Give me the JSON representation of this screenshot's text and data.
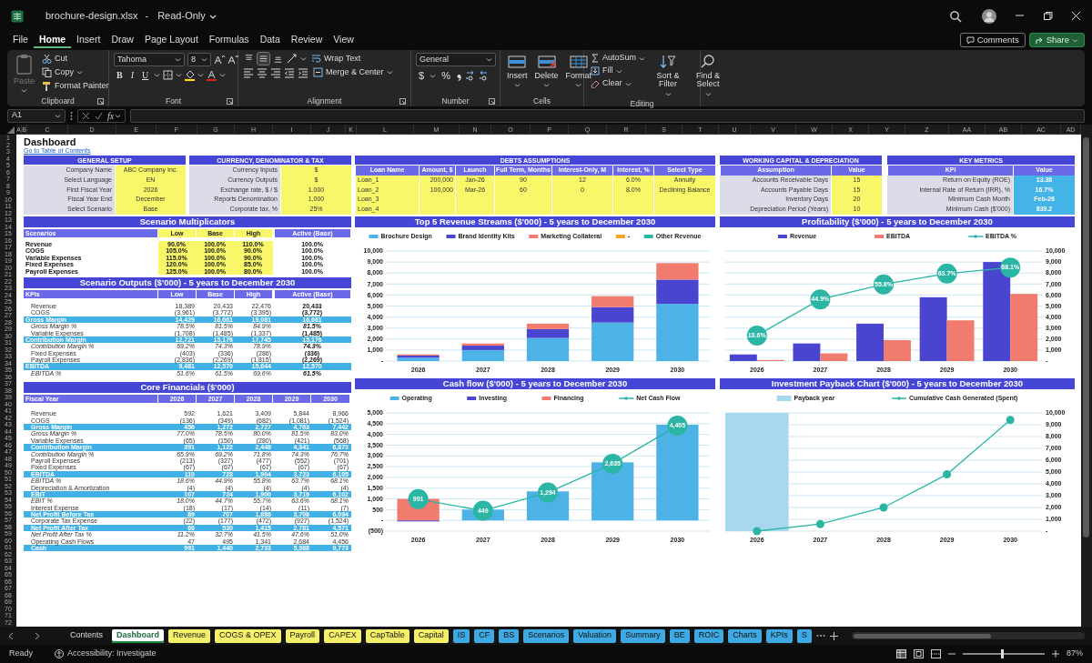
{
  "window": {
    "title": "brochure-design.xlsx",
    "separator": "-",
    "mode": "Read-Only"
  },
  "menu_tabs": [
    {
      "label": "File",
      "selected": false
    },
    {
      "label": "Home",
      "selected": true
    },
    {
      "label": "Insert",
      "selected": false
    },
    {
      "label": "Draw",
      "selected": false
    },
    {
      "label": "Page Layout",
      "selected": false
    },
    {
      "label": "Formulas",
      "selected": false
    },
    {
      "label": "Data",
      "selected": false
    },
    {
      "label": "Review",
      "selected": false
    },
    {
      "label": "View",
      "selected": false
    }
  ],
  "header_buttons": [
    {
      "label": "Comments",
      "kind": "outline"
    },
    {
      "label": "Share",
      "kind": "primary"
    }
  ],
  "ribbon": {
    "clipboard": {
      "title": "Clipboard",
      "paste": {
        "label": "Paste",
        "disabled": true
      },
      "cut": "Cut",
      "copy": "Copy",
      "format_painter": "Format Painter"
    },
    "font": {
      "title": "Font",
      "name": "Tahoma",
      "size": "8",
      "styles": [
        "B",
        "I",
        "U"
      ]
    },
    "alignment": {
      "title": "Alignment",
      "vertical_align": [
        {
          "selected": false
        },
        {
          "selected": true
        },
        {
          "selected": false
        }
      ],
      "wrap": "Wrap Text",
      "merge": "Merge & Center"
    },
    "number": {
      "title": "Number",
      "format": "General",
      "symbols": [
        "$",
        "%"
      ]
    },
    "cells": {
      "title": "Cells",
      "buttons": [
        "Insert",
        "Delete",
        "Format"
      ]
    },
    "editing": {
      "title": "Editing",
      "autosum": "AutoSum",
      "fill": "Fill",
      "clear": "Clear",
      "sort": "Sort & Filter",
      "find": "Find & Select"
    }
  },
  "formula_bar": {
    "cell": "A1",
    "fx": "fx"
  },
  "column_headers": [
    "A",
    "B",
    "C",
    "D",
    "E",
    "F",
    "G",
    "H",
    "I",
    "J",
    "K",
    "L",
    "M",
    "N",
    "O",
    "P",
    "Q",
    "R",
    "S",
    "T",
    "U",
    "V",
    "W",
    "X",
    "Y",
    "Z",
    "AA",
    "AB",
    "AC",
    "AD"
  ],
  "row_headers": [
    "1",
    "2",
    "3",
    "4",
    "5",
    "6",
    "7",
    "8",
    "9",
    "10",
    "11",
    "12",
    "13",
    "14",
    "15",
    "16",
    "17",
    "18",
    "19",
    "20",
    "21",
    "22",
    "23",
    "24",
    "25",
    "26",
    "27",
    "28",
    "29",
    "30",
    "31",
    "32",
    "33",
    "34",
    "35",
    "36",
    "37",
    "38",
    "39",
    "40",
    "41",
    "42",
    "43",
    "44",
    "45",
    "46",
    "47",
    "48",
    "49",
    "50",
    "51",
    "52",
    "53",
    "54",
    "55",
    "56",
    "57",
    "58",
    "59",
    "60",
    "61",
    "62",
    "63",
    "64",
    "65",
    "66",
    "67",
    "68",
    "69",
    "70",
    "71",
    "72"
  ],
  "sheet": {
    "title": "Dashboard",
    "link": "Go to Table of Contents",
    "general_setup": {
      "title": "GENERAL SETUP",
      "rows": [
        [
          "Company Name",
          "ABC Company Inc."
        ],
        [
          "Select Language",
          "EN"
        ],
        [
          "First Fiscal Year",
          "2026"
        ],
        [
          "Fiscal Year End",
          "December"
        ],
        [
          "Select Scenario",
          "Base"
        ]
      ]
    },
    "currency": {
      "title": "CURRENCY, DENOMINATOR & TAX",
      "rows": [
        [
          "Currency Inputs",
          "$"
        ],
        [
          "Currency Outputs",
          "$"
        ],
        [
          "Exchange rate, $ / $",
          "1.000"
        ],
        [
          "Reports Denomination",
          "1,000"
        ],
        [
          "Corporate tax, %",
          "25%"
        ]
      ]
    },
    "debts": {
      "title": "DEBTS ASSUMPTIONS",
      "columns": [
        "Loan Name",
        "Amount, $",
        "Launch",
        "Full Term, Months",
        "Interest-Only, M",
        "Interest, %",
        "Select Type"
      ],
      "rows": [
        [
          "Loan_1",
          "200,000",
          "Jan-26",
          "90",
          "12",
          "6.0%",
          "Annuity"
        ],
        [
          "Loan_2",
          "100,000",
          "Mar-26",
          "60",
          "0",
          "8.0%",
          "Declining Balance"
        ],
        [
          "Loan_3"
        ],
        [
          "Loan_4"
        ]
      ]
    },
    "working_capital": {
      "title": "WORKING CAPITAL & DEPRECIATION",
      "columns": [
        "Assumption",
        "Value"
      ],
      "rows": [
        [
          "Accounts Receivable Days",
          "15"
        ],
        [
          "Accounts Payable Days",
          "15"
        ],
        [
          "Inventory Days",
          "20"
        ],
        [
          "Depreciation Period (Years)",
          "10"
        ]
      ]
    },
    "key_metrics": {
      "title": "KEY METRICS",
      "columns": [
        "KPI",
        "Value"
      ],
      "rows": [
        [
          "Return on Equity (ROE)",
          "13.38"
        ],
        [
          "Internal Rate of Return (IRR), %",
          "16.7%"
        ],
        [
          "Minimum Cash Month",
          "Feb-26"
        ],
        [
          "Minimum Cash ($'000)",
          "839.2"
        ]
      ]
    },
    "scenario_multiplicators": {
      "title": "Scenario Multiplicators",
      "columns": [
        "Scenarios",
        "Low",
        "Base",
        "High",
        "Active (Base)"
      ],
      "rows": [
        {
          "label": "Revenue",
          "values": [
            "90.0%",
            "100.0%",
            "110.0%",
            "100.0%"
          ]
        },
        {
          "label": "COGS",
          "values": [
            "105.0%",
            "100.0%",
            "90.0%",
            "100.0%"
          ]
        },
        {
          "label": "Variable Expenses",
          "values": [
            "115.0%",
            "100.0%",
            "90.0%",
            "100.0%"
          ]
        },
        {
          "label": "Fixed Expenses",
          "values": [
            "120.0%",
            "100.0%",
            "85.0%",
            "100.0%"
          ]
        },
        {
          "label": "Payroll Expenses",
          "values": [
            "125.0%",
            "100.0%",
            "80.0%",
            "100.0%"
          ]
        }
      ]
    },
    "scenario_outputs": {
      "title": "Scenario Outputs ($'000) - 5 years to December 2030",
      "columns": [
        "KPIs",
        "Low",
        "Base",
        "High",
        "Active (Base)"
      ],
      "rows": [
        {
          "label": "Revenue",
          "kind": "item",
          "values": [
            "18,389",
            "20,433",
            "22,476",
            "20,433"
          ]
        },
        {
          "label": "COGS",
          "kind": "item",
          "values": [
            "(3,961)",
            "(3,772)",
            "(3,395)",
            "(3,772)"
          ]
        },
        {
          "label": "Gross Margin",
          "kind": "band",
          "values": [
            "14,429",
            "16,661",
            "19,081",
            "16,661"
          ]
        },
        {
          "label": "Gross Margin %",
          "kind": "pct",
          "values": [
            "78.5%",
            "81.5%",
            "84.9%",
            "81.5%"
          ]
        },
        {
          "label": "Variable Expenses",
          "kind": "item",
          "values": [
            "(1,708)",
            "(1,485)",
            "(1,337)",
            "(1,485)"
          ]
        },
        {
          "label": "Contribution Margin",
          "kind": "band",
          "values": [
            "12,721",
            "15,176",
            "17,745",
            "15,176"
          ]
        },
        {
          "label": "Contribution Margin %",
          "kind": "pct",
          "values": [
            "69.2%",
            "74.3%",
            "78.9%",
            "74.3%"
          ]
        },
        {
          "label": "Fixed Expenses",
          "kind": "item",
          "values": [
            "(403)",
            "(336)",
            "(286)",
            "(336)"
          ]
        },
        {
          "label": "Payroll Expenses",
          "kind": "item",
          "values": [
            "(2,836)",
            "(2,269)",
            "(1,815)",
            "(2,269)"
          ]
        },
        {
          "label": "EBITDA",
          "kind": "band",
          "values": [
            "9,481",
            "12,570",
            "15,644",
            "12,570"
          ]
        },
        {
          "label": "EBITDA %",
          "kind": "pct",
          "values": [
            "51.6%",
            "61.5%",
            "69.6%",
            "61.5%"
          ]
        }
      ]
    },
    "core_financials": {
      "title": "Core Financials ($'000)",
      "columns": [
        "Fiscal Year",
        "2026",
        "2027",
        "2028",
        "2029",
        "2030"
      ],
      "rows": [
        {
          "label": "Revenue",
          "kind": "item",
          "values": [
            "592",
            "1,621",
            "3,409",
            "5,844",
            "8,966"
          ]
        },
        {
          "label": "COGS",
          "kind": "item",
          "values": [
            "(136)",
            "(349)",
            "(682)",
            "(1,081)",
            "(1,524)"
          ]
        },
        {
          "label": "Gross Margin",
          "kind": "band",
          "values": [
            "456",
            "1,272",
            "2,727",
            "4,763",
            "7,442"
          ]
        },
        {
          "label": "Gross Margin %",
          "kind": "pct",
          "values": [
            "77.0%",
            "78.5%",
            "80.0%",
            "81.5%",
            "83.0%"
          ]
        },
        {
          "label": "Variable Expenses",
          "kind": "item",
          "values": [
            "(65)",
            "(150)",
            "(280)",
            "(421)",
            "(568)"
          ]
        },
        {
          "label": "Contribution Margin",
          "kind": "band",
          "values": [
            "391",
            "1,122",
            "2,448",
            "4,341",
            "6,873"
          ]
        },
        {
          "label": "Contribution Margin %",
          "kind": "pct",
          "values": [
            "65.9%",
            "69.2%",
            "71.8%",
            "74.3%",
            "76.7%"
          ]
        },
        {
          "label": "Payroll Expenses",
          "kind": "item",
          "values": [
            "(213)",
            "(327)",
            "(477)",
            "(552)",
            "(701)"
          ]
        },
        {
          "label": "Fixed Expenses",
          "kind": "item",
          "values": [
            "(67)",
            "(67)",
            "(67)",
            "(67)",
            "(67)"
          ]
        },
        {
          "label": "EBITDA",
          "kind": "band",
          "values": [
            "110",
            "728",
            "1,904",
            "3,723",
            "6,105"
          ]
        },
        {
          "label": "EBITDA %",
          "kind": "pct",
          "values": [
            "18.6%",
            "44.9%",
            "55.8%",
            "63.7%",
            "68.1%"
          ]
        },
        {
          "label": "Depreciation & Amortization",
          "kind": "item",
          "values": [
            "(4)",
            "(4)",
            "(4)",
            "(4)",
            "(4)"
          ]
        },
        {
          "label": "EBIT",
          "kind": "band",
          "values": [
            "107",
            "724",
            "1,900",
            "3,719",
            "6,102"
          ]
        },
        {
          "label": "EBIT %",
          "kind": "pct",
          "values": [
            "18.0%",
            "44.7%",
            "55.7%",
            "63.6%",
            "68.1%"
          ]
        },
        {
          "label": "Interest Expense",
          "kind": "item",
          "values": [
            "(18)",
            "(17)",
            "(14)",
            "(11)",
            "(7)"
          ]
        },
        {
          "label": "Net Profit Before Tax",
          "kind": "band",
          "values": [
            "89",
            "707",
            "1,886",
            "3,708",
            "6,094"
          ]
        },
        {
          "label": "Corporate Tax Expense",
          "kind": "item",
          "values": [
            "(22)",
            "(177)",
            "(472)",
            "(927)",
            "(1,524)"
          ]
        },
        {
          "label": "Net Profit After Tax",
          "kind": "band",
          "values": [
            "66",
            "530",
            "1,415",
            "2,781",
            "4,571"
          ]
        },
        {
          "label": "Net Profit After Tax %",
          "kind": "pct",
          "values": [
            "11.2%",
            "32.7%",
            "41.5%",
            "47.6%",
            "51.0%"
          ]
        },
        {
          "label": "Operating Cash Flows",
          "kind": "item",
          "values": [
            "47",
            "495",
            "1,341",
            "2,684",
            "4,456"
          ]
        },
        {
          "label": "Cash",
          "kind": "band",
          "values": [
            "991",
            "1,440",
            "2,733",
            "5,368",
            "9,773"
          ]
        }
      ]
    },
    "revenue_chart": {
      "chart_data": {
        "type": "bar",
        "title": "Top 5 Revenue Streams ($'000) - 5 years to December 2030",
        "stacked": true,
        "grid": true,
        "legend": "top",
        "categories": [
          "2026",
          "2027",
          "2028",
          "2029",
          "2030"
        ],
        "ylim": [
          0,
          10000
        ],
        "yticks": [
          {
            "value": 0,
            "label": "-"
          },
          {
            "value": 1000,
            "label": "1,000"
          },
          {
            "value": 2000,
            "label": "2,000"
          },
          {
            "value": 3000,
            "label": "3,000"
          },
          {
            "value": 4000,
            "label": "4,000"
          },
          {
            "value": 5000,
            "label": "5,000"
          },
          {
            "value": 6000,
            "label": "6,000"
          },
          {
            "value": 7000,
            "label": "7,000"
          },
          {
            "value": 8000,
            "label": "8,000"
          },
          {
            "value": 9000,
            "label": "9,000"
          },
          {
            "value": 10000,
            "label": "10,000"
          }
        ],
        "series": [
          {
            "name": "Brochure Design",
            "type": "bar",
            "color": "#4db3e6",
            "values": [
              300,
              1000,
              2100,
              3500,
              5200
            ]
          },
          {
            "name": "Brand Identity Kits",
            "type": "bar",
            "color": "#4a45d0",
            "values": [
              200,
              400,
              800,
              1400,
              2200
            ]
          },
          {
            "name": "Marketing Collateral",
            "type": "bar",
            "color": "#f07b6e",
            "values": [
              100,
              200,
              500,
              1000,
              1500
            ]
          },
          {
            "name": "-",
            "type": "bar",
            "color": "#f5a623",
            "values": [
              0,
              0,
              0,
              0,
              0
            ]
          },
          {
            "name": "Other Revenue",
            "type": "bar",
            "color": "#2bb5a5",
            "values": [
              0,
              0,
              0,
              0,
              0
            ]
          }
        ]
      }
    },
    "profitability_chart": {
      "chart_data": {
        "type": "bar",
        "title": "Profitability ($'000) - 5 years to December 2030",
        "stacked": false,
        "grid": true,
        "legend": "top",
        "categories": [
          "2026",
          "2027",
          "2028",
          "2029",
          "2030"
        ],
        "ylim": [
          0,
          10000
        ],
        "yticks": [
          {
            "value": 0,
            "label": "-"
          },
          {
            "value": 1000,
            "label": "1,000"
          },
          {
            "value": 2000,
            "label": "2,000"
          },
          {
            "value": 3000,
            "label": "3,000"
          },
          {
            "value": 4000,
            "label": "4,000"
          },
          {
            "value": 5000,
            "label": "5,000"
          },
          {
            "value": 6000,
            "label": "6,000"
          },
          {
            "value": 7000,
            "label": "7,000"
          },
          {
            "value": 8000,
            "label": "8,000"
          },
          {
            "value": 9000,
            "label": "9,000"
          },
          {
            "value": 10000,
            "label": "10,000"
          }
        ],
        "series": [
          {
            "name": "Revenue",
            "type": "bar",
            "color": "#4a45d0",
            "values": [
              600,
              1600,
              3400,
              5800,
              9000
            ]
          },
          {
            "name": "EBITDA",
            "type": "bar",
            "color": "#f07b6e",
            "values": [
              100,
              700,
              1900,
              3700,
              6100
            ]
          },
          {
            "name": "EBITDA %",
            "type": "line",
            "axis": "y2",
            "marker": "o",
            "color": "#2bb5a5",
            "values": [
              18.6,
              44.9,
              55.8,
              63.7,
              68.1
            ],
            "value_labels": [
              "18.6%",
              "44.9%",
              "55.8%",
              "63.7%",
              "68.1%"
            ]
          }
        ]
      }
    },
    "cash_flow_chart": {
      "chart_data": {
        "type": "bar",
        "title": "Cash flow ($'000) - 5 years to December 2030",
        "stacked": true,
        "grid": true,
        "legend": "top",
        "categories": [
          "2026",
          "2027",
          "2028",
          "2029",
          "2030"
        ],
        "ylim": [
          -500,
          5000
        ],
        "yticks": [
          {
            "value": -500,
            "label": "(500)"
          },
          {
            "value": 0,
            "label": "-"
          },
          {
            "value": 500,
            "label": "500"
          },
          {
            "value": 1000,
            "label": "1,000"
          },
          {
            "value": 1500,
            "label": "1,500"
          },
          {
            "value": 2000,
            "label": "2,000"
          },
          {
            "value": 2500,
            "label": "2,500"
          },
          {
            "value": 3000,
            "label": "3,000"
          },
          {
            "value": 3500,
            "label": "3,500"
          },
          {
            "value": 4000,
            "label": "4,000"
          },
          {
            "value": 4500,
            "label": "4,500"
          },
          {
            "value": 5000,
            "label": "5,000"
          }
        ],
        "series": [
          {
            "name": "Operating",
            "type": "bar",
            "color": "#4db3e6",
            "values": [
              0,
              500,
              1350,
              2700,
              4450
            ]
          },
          {
            "name": "Investing",
            "type": "bar",
            "color": "#4a45d0",
            "values": [
              -50,
              0,
              0,
              0,
              0
            ]
          },
          {
            "name": "Financing",
            "type": "bar",
            "color": "#f07b6e",
            "values": [
              1000,
              0,
              0,
              0,
              0
            ]
          },
          {
            "name": "Net Cash Flow",
            "type": "line",
            "marker": "o",
            "color": "#2bb5a5",
            "values": [
              991,
              449,
              1294,
              2635,
              4405
            ],
            "value_labels": [
              "991",
              "449",
              "1,294",
              "2,635",
              "4,405"
            ]
          }
        ]
      }
    },
    "payback_chart": {
      "chart_data": {
        "type": "line",
        "title": "Investment Payback Chart ($'000) - 5 years to December 2030",
        "grid": true,
        "legend": "top",
        "categories": [
          "2026",
          "2027",
          "2028",
          "2029",
          "2030"
        ],
        "ylim": [
          0,
          10000
        ],
        "yticks": [
          {
            "value": 0,
            "label": "-"
          },
          {
            "value": 1000,
            "label": "1,000"
          },
          {
            "value": 2000,
            "label": "2,000"
          },
          {
            "value": 3000,
            "label": "3,000"
          },
          {
            "value": 4000,
            "label": "4,000"
          },
          {
            "value": 5000,
            "label": "5,000"
          },
          {
            "value": 6000,
            "label": "6,000"
          },
          {
            "value": 7000,
            "label": "7,000"
          },
          {
            "value": 8000,
            "label": "8,000"
          },
          {
            "value": 9000,
            "label": "9,000"
          },
          {
            "value": 10000,
            "label": "10,000"
          }
        ],
        "series": [
          {
            "name": "Payback year",
            "type": "bar",
            "color": "#a8d8f0",
            "values": [
              10000,
              null,
              null,
              null,
              null
            ]
          },
          {
            "name": "Cumulative Cash Generated (Spent)",
            "type": "line",
            "marker": "o",
            "color": "#2bb5a5",
            "values": [
              0,
              600,
              2000,
              4800,
              9400
            ]
          }
        ]
      }
    }
  },
  "sheet_tabs": [
    {
      "label": "Contents",
      "selected": false
    },
    {
      "label": "Dashboard",
      "selected": true
    },
    {
      "label": "Revenue",
      "selected": false,
      "color": "#f5f06a"
    },
    {
      "label": "COGS & OPEX",
      "selected": false,
      "color": "#f5f06a"
    },
    {
      "label": "Payroll",
      "selected": false,
      "color": "#f5f06a"
    },
    {
      "label": "CAPEX",
      "selected": false,
      "color": "#f5f06a"
    },
    {
      "label": "CapTable",
      "selected": false,
      "color": "#f5f06a"
    },
    {
      "label": "Capital",
      "selected": false,
      "color": "#f5f06a"
    },
    {
      "label": "IS",
      "selected": false,
      "color": "#3ea9e2"
    },
    {
      "label": "CF",
      "selected": false,
      "color": "#3ea9e2"
    },
    {
      "label": "BS",
      "selected": false,
      "color": "#3ea9e2"
    },
    {
      "label": "Scenarios",
      "selected": false,
      "color": "#3ea9e2"
    },
    {
      "label": "Valuation",
      "selected": false,
      "color": "#3ea9e2"
    },
    {
      "label": "Summary",
      "selected": false,
      "color": "#3ea9e2"
    },
    {
      "label": "BE",
      "selected": false,
      "color": "#3ea9e2"
    },
    {
      "label": "ROIC",
      "selected": false,
      "color": "#3ea9e2"
    },
    {
      "label": "Charts",
      "selected": false,
      "color": "#3ea9e2"
    },
    {
      "label": "KPIs",
      "selected": false,
      "color": "#3ea9e2"
    },
    {
      "label": "S",
      "selected": false,
      "color": "#3ea9e2"
    }
  ],
  "status_bar": {
    "ready": "Ready",
    "accessibility": "Accessibility: Investigate",
    "zoom": "87%",
    "zoom_slider": {
      "level": 0.48
    }
  }
}
